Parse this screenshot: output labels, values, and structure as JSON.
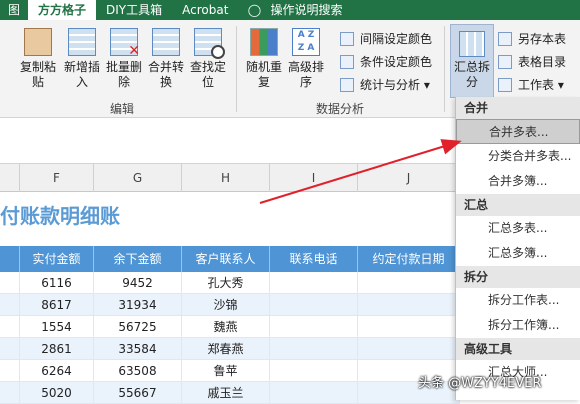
{
  "tabs": {
    "partial": "图",
    "active": "方方格子",
    "diy": "DIY工具箱",
    "acrobat": "Acrobat",
    "help": "操作说明搜索"
  },
  "ribbon": {
    "copy_paste": "复制粘贴",
    "new_insert": "新增插入",
    "batch_delete": "批量删除",
    "merge_convert": "合并转换",
    "find_locate": "查找定位",
    "random_repeat": "随机重复",
    "advanced_sort": "高级排序",
    "interval_color": "间隔设定颜色",
    "cond_color": "条件设定颜色",
    "stats_analysis": "统计与分析",
    "summary_split": "汇总拆分",
    "save_table": "另存本表",
    "table_dir": "表格目录",
    "worksheet": "工作表",
    "group_edit": "编辑",
    "group_data": "数据分析"
  },
  "columns": [
    "F",
    "G",
    "H",
    "I",
    "J"
  ],
  "sheet": {
    "title": "付账款明细账",
    "headers": [
      "实付金额",
      "余下金额",
      "客户联系人",
      "联系电话",
      "约定付款日期"
    ],
    "rows": [
      [
        "6116",
        "9452",
        "孔大秀",
        "",
        ""
      ],
      [
        "8617",
        "31934",
        "沙锦",
        "",
        ""
      ],
      [
        "1554",
        "56725",
        "魏燕",
        "",
        ""
      ],
      [
        "2861",
        "33584",
        "郑春燕",
        "",
        ""
      ],
      [
        "6264",
        "63508",
        "鲁苹",
        "",
        ""
      ],
      [
        "5020",
        "55667",
        "戚玉兰",
        "",
        ""
      ]
    ]
  },
  "dropdown": {
    "sec_merge": "合并",
    "merge_multi": "合并多表...",
    "merge_classify": "分类合并多表...",
    "merge_books": "合并多簿...",
    "sec_summary": "汇总",
    "sum_multi_tables": "汇总多表...",
    "sum_multi_books": "汇总多簿...",
    "sec_split": "拆分",
    "split_sheet": "拆分工作表...",
    "split_book": "拆分工作簿...",
    "sec_advanced": "高级工具",
    "sum_master": "汇总大师..."
  },
  "watermark": "头条 @WZYY4EVER",
  "colors": {
    "accent": "#217346",
    "header_blue": "#4f94d4",
    "title_blue": "#5b9bd5",
    "arrow_red": "#e0202a"
  }
}
